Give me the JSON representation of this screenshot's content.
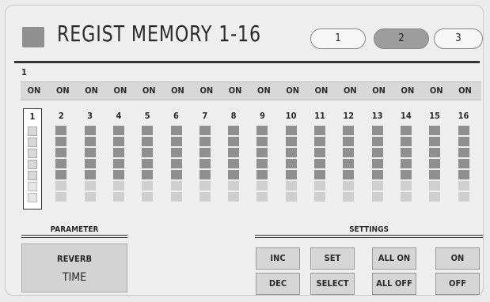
{
  "header": {
    "title": "REGIST MEMORY 1-16",
    "pages": [
      "1",
      "2",
      "3"
    ],
    "active_page": "2"
  },
  "bank": {
    "label": "1"
  },
  "on_row": [
    "ON",
    "ON",
    "ON",
    "ON",
    "ON",
    "ON",
    "ON",
    "ON",
    "ON",
    "ON",
    "ON",
    "ON",
    "ON",
    "ON",
    "ON",
    "ON"
  ],
  "memories": [
    "1",
    "2",
    "3",
    "4",
    "5",
    "6",
    "7",
    "8",
    "9",
    "10",
    "11",
    "12",
    "13",
    "14",
    "15",
    "16"
  ],
  "selected_memory": "1",
  "parameter": {
    "section_label": "PARAMETER",
    "line1": "REVERB",
    "line2": "TIME"
  },
  "settings": {
    "section_label": "SETTINGS",
    "buttons": {
      "inc": "INC",
      "set": "SET",
      "all_on": "ALL ON",
      "on": "ON",
      "dec": "DEC",
      "select": "SELECT",
      "all_off": "ALL OFF",
      "off": "OFF"
    }
  },
  "colors": {
    "active_page": "#9d9d9d",
    "bar_dark": "#8f8f8f",
    "bar_light": "#cfcfcf"
  }
}
